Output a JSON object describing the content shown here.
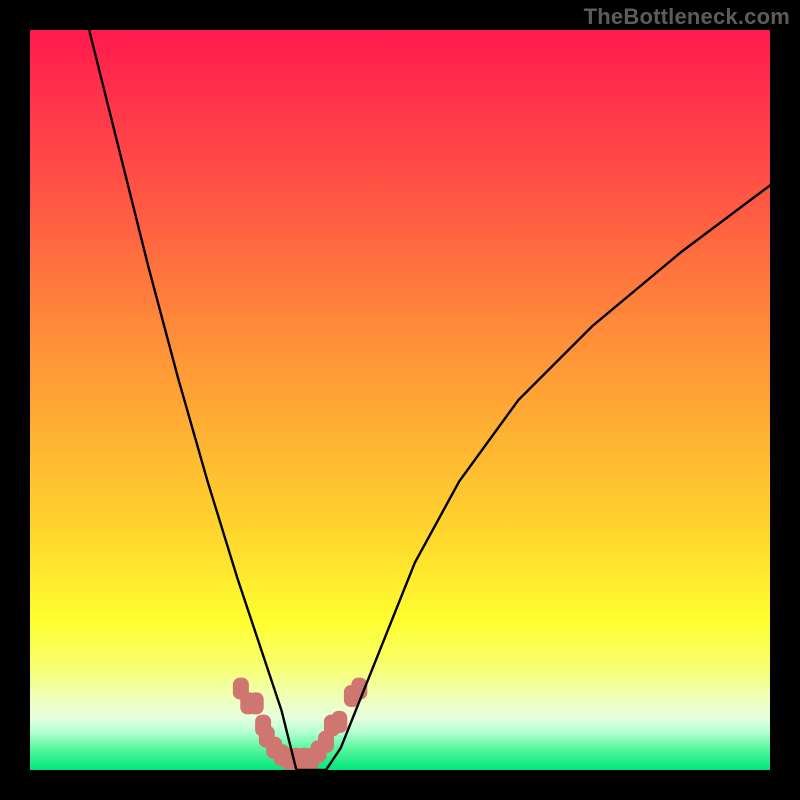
{
  "watermark": "TheBottleneck.com",
  "chart_data": {
    "type": "line",
    "title": "",
    "xlabel": "",
    "ylabel": "",
    "xlim": [
      0,
      100
    ],
    "ylim": [
      0,
      100
    ],
    "grid": false,
    "legend": false,
    "series": [
      {
        "name": "curve",
        "color": "#000000",
        "x": [
          8,
          12,
          16,
          20,
          24,
          28,
          30,
          32,
          34,
          35,
          36,
          38,
          40,
          42,
          44,
          48,
          52,
          58,
          66,
          76,
          88,
          100
        ],
        "y": [
          100,
          84,
          68,
          53,
          39,
          26,
          20,
          14,
          8,
          4,
          0,
          0,
          0,
          3,
          8,
          18,
          28,
          39,
          50,
          60,
          70,
          79
        ]
      },
      {
        "name": "marker-band",
        "color": "#cf7670",
        "x": [
          28.5,
          29.5,
          30.5,
          31.5,
          32.0,
          33.0,
          34.0,
          35.0,
          36.0,
          37.0,
          38.0,
          39.0,
          40.0,
          40.8,
          41.8,
          43.5,
          44.5
        ],
        "y": [
          11.0,
          9.0,
          9.0,
          6.0,
          4.5,
          3.0,
          2.0,
          1.5,
          1.5,
          1.5,
          1.5,
          2.5,
          3.8,
          6.0,
          6.5,
          10.0,
          11.0
        ]
      }
    ]
  }
}
